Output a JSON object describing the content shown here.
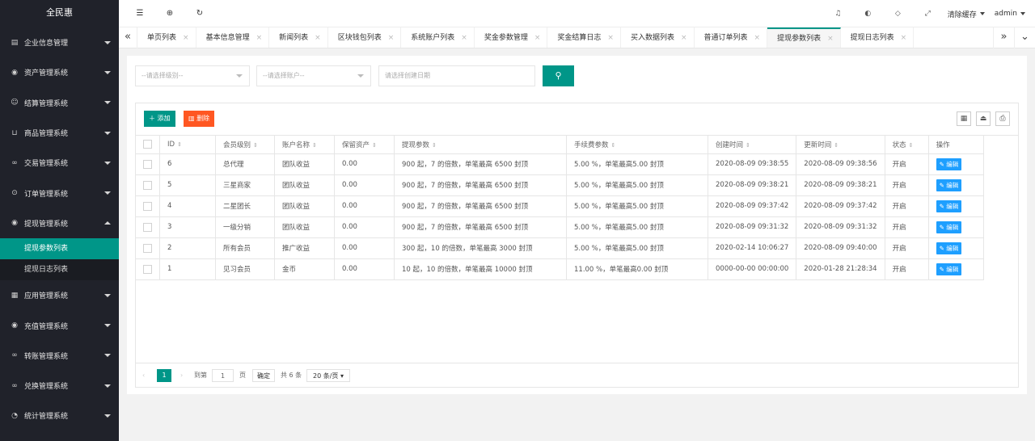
{
  "app": {
    "brand": "全民惠"
  },
  "sidebar": {
    "items": [
      {
        "label": "企业信息管理",
        "icon": "form-icon"
      },
      {
        "label": "资产管理系统",
        "icon": "asset-icon"
      },
      {
        "label": "结算管理系统",
        "icon": "smile-icon"
      },
      {
        "label": "商品管理系统",
        "icon": "cart-icon"
      },
      {
        "label": "交易管理系统",
        "icon": "link-icon"
      },
      {
        "label": "订单管理系统",
        "icon": "location-icon"
      },
      {
        "label": "提现管理系统",
        "icon": "withdraw-icon"
      },
      {
        "label": "应用管理系统",
        "icon": "app-icon"
      },
      {
        "label": "充值管理系统",
        "icon": "recharge-icon"
      },
      {
        "label": "转账管理系统",
        "icon": "transfer-icon"
      },
      {
        "label": "兑换管理系统",
        "icon": "exchange-icon"
      },
      {
        "label": "统计管理系统",
        "icon": "dashboard-icon"
      }
    ],
    "submenu": [
      {
        "label": "提现参数列表"
      },
      {
        "label": "提现日志列表"
      }
    ]
  },
  "header": {
    "clear_cache": "清除缓存",
    "user": "admin"
  },
  "tabs": [
    {
      "label": "单页列表"
    },
    {
      "label": "基本信息管理"
    },
    {
      "label": "新闻列表"
    },
    {
      "label": "区块钱包列表"
    },
    {
      "label": "系统账户列表"
    },
    {
      "label": "奖金参数管理"
    },
    {
      "label": "奖金结算日志"
    },
    {
      "label": "买入数据列表"
    },
    {
      "label": "普通订单列表"
    },
    {
      "label": "提现参数列表"
    },
    {
      "label": "提现日志列表"
    }
  ],
  "filters": {
    "level_placeholder": "--请选择级别--",
    "account_placeholder": "--请选择账户--",
    "date_placeholder": "请选择创建日期"
  },
  "toolbar": {
    "add_label": "添加",
    "delete_label": "删除"
  },
  "table": {
    "headers": [
      "ID",
      "会员级别",
      "账户名称",
      "保留资产",
      "提现参数",
      "手续费参数",
      "创建时间",
      "更新时间",
      "状态",
      "操作"
    ],
    "edit_label": "编辑",
    "rows": [
      {
        "id": "6",
        "level": "总代理",
        "account": "团队收益",
        "reserve": "0.00",
        "withdraw": "900 起，7 的倍数，单笔最高 6500 封顶",
        "fee": "5.00 %，单笔最高5.00 封顶",
        "created": "2020-08-09 09:38:55",
        "updated": "2020-08-09 09:38:56",
        "status": "开启"
      },
      {
        "id": "5",
        "level": "三星商家",
        "account": "团队收益",
        "reserve": "0.00",
        "withdraw": "900 起，7 的倍数，单笔最高 6500 封顶",
        "fee": "5.00 %，单笔最高5.00 封顶",
        "created": "2020-08-09 09:38:21",
        "updated": "2020-08-09 09:38:21",
        "status": "开启"
      },
      {
        "id": "4",
        "level": "二星团长",
        "account": "团队收益",
        "reserve": "0.00",
        "withdraw": "900 起，7 的倍数，单笔最高 6500 封顶",
        "fee": "5.00 %，单笔最高5.00 封顶",
        "created": "2020-08-09 09:37:42",
        "updated": "2020-08-09 09:37:42",
        "status": "开启"
      },
      {
        "id": "3",
        "level": "一级分销",
        "account": "团队收益",
        "reserve": "0.00",
        "withdraw": "900 起，7 的倍数，单笔最高 6500 封顶",
        "fee": "5.00 %，单笔最高5.00 封顶",
        "created": "2020-08-09 09:31:32",
        "updated": "2020-08-09 09:31:32",
        "status": "开启"
      },
      {
        "id": "2",
        "level": "所有会员",
        "account": "推广收益",
        "reserve": "0.00",
        "withdraw": "300 起，10 的倍数，单笔最高 3000 封顶",
        "fee": "5.00 %，单笔最高5.00 封顶",
        "created": "2020-02-14 10:06:27",
        "updated": "2020-08-09 09:40:00",
        "status": "开启"
      },
      {
        "id": "1",
        "level": "见习会员",
        "account": "金币",
        "reserve": "0.00",
        "withdraw": "10 起，10 的倍数，单笔最高 10000 封顶",
        "fee": "11.00 %，单笔最高0.00 封顶",
        "created": "0000-00-00 00:00:00",
        "updated": "2020-01-28 21:28:34",
        "status": "开启"
      }
    ]
  },
  "pagination": {
    "current": "1",
    "goto_label": "到第",
    "page_input": "1",
    "page_suffix": "页",
    "confirm": "确定",
    "total": "共 6 条",
    "per_page": "20 条/页"
  },
  "colors": {
    "accent": "#009688",
    "danger": "#ff5722",
    "info": "#1e9fff",
    "sidebar": "#20222a"
  }
}
